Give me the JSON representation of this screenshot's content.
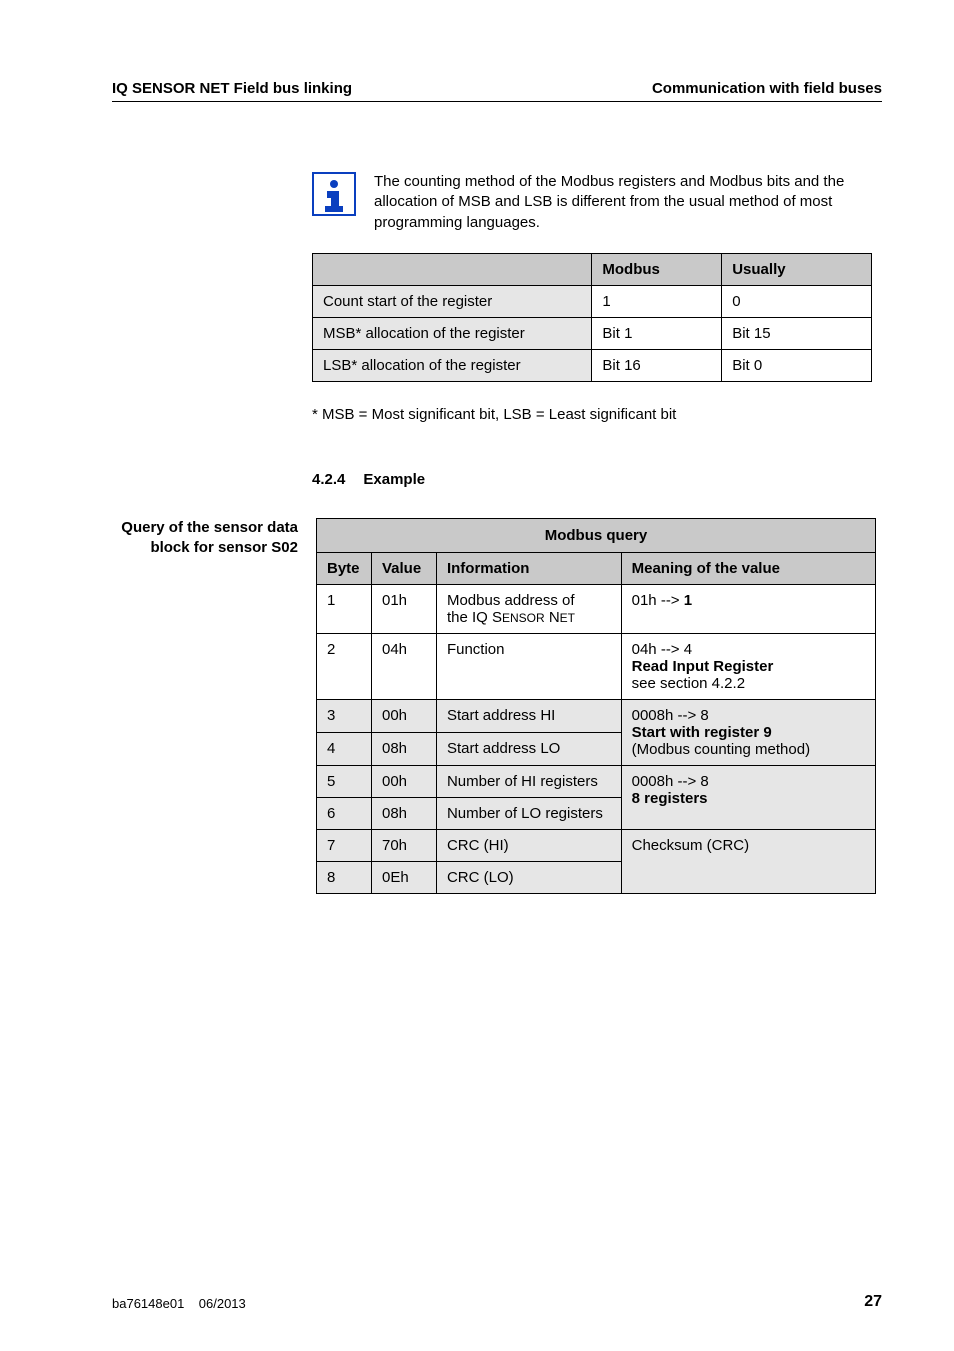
{
  "header": {
    "left": "IQ SENSOR NET Field bus linking",
    "right": "Communication with field buses"
  },
  "info": {
    "text": "The counting method of the Modbus registers and Modbus bits and the allocation of MSB and LSB is different from the usual method of most programming languages."
  },
  "table1": {
    "headers": {
      "blank": "",
      "modbus": "Modbus",
      "usually": "Usually"
    },
    "rows": [
      {
        "label": "Count start of the register",
        "modbus": "1",
        "usually": "0"
      },
      {
        "label": "MSB* allocation of the register",
        "modbus": "Bit 1",
        "usually": "Bit 15"
      },
      {
        "label": "LSB* allocation of the register",
        "modbus": "Bit 16",
        "usually": "Bit 0"
      }
    ]
  },
  "footnote": "* MSB = Most significant bit, LSB = Least significant bit",
  "section": {
    "num": "4.2.4",
    "title": "Example"
  },
  "sidelabel": {
    "l1": "Query of the sensor data",
    "l2": "block for sensor S02"
  },
  "table2": {
    "title": "Modbus query",
    "headers": {
      "byte": "Byte",
      "value": "Value",
      "info": "Information",
      "meaning": "Meaning of the value"
    },
    "rows": {
      "r1": {
        "byte": "1",
        "value": "01h",
        "info_a": "Modbus address of",
        "info_b": "the IQ S",
        "info_c": "ENSOR",
        "info_d": " N",
        "info_e": "ET",
        "mean_a": "01h --> ",
        "mean_b": "1"
      },
      "r2": {
        "byte": "2",
        "value": "04h",
        "info": "Function",
        "mean_a": "04h --> 4",
        "mean_b": "Read Input Register",
        "mean_c": "see section 4.2.2"
      },
      "r3": {
        "byte": "3",
        "value": "00h",
        "info": "Start address HI",
        "mean_a": "0008h --> 8",
        "mean_b": "Start with register 9",
        "mean_c": "(Modbus counting method)"
      },
      "r4": {
        "byte": "4",
        "value": "08h",
        "info": "Start address LO"
      },
      "r5": {
        "byte": "5",
        "value": "00h",
        "info": "Number of HI registers",
        "mean_a": "0008h --> 8",
        "mean_b": "8 registers"
      },
      "r6": {
        "byte": "6",
        "value": "08h",
        "info": "Number of LO registers"
      },
      "r7": {
        "byte": "7",
        "value": "70h",
        "info": "CRC (HI)",
        "mean": "Checksum (CRC)"
      },
      "r8": {
        "byte": "8",
        "value": "0Eh",
        "info": "CRC (LO)"
      }
    }
  },
  "footer": {
    "doc": "ba76148e01",
    "date": "06/2013",
    "page": "27"
  }
}
